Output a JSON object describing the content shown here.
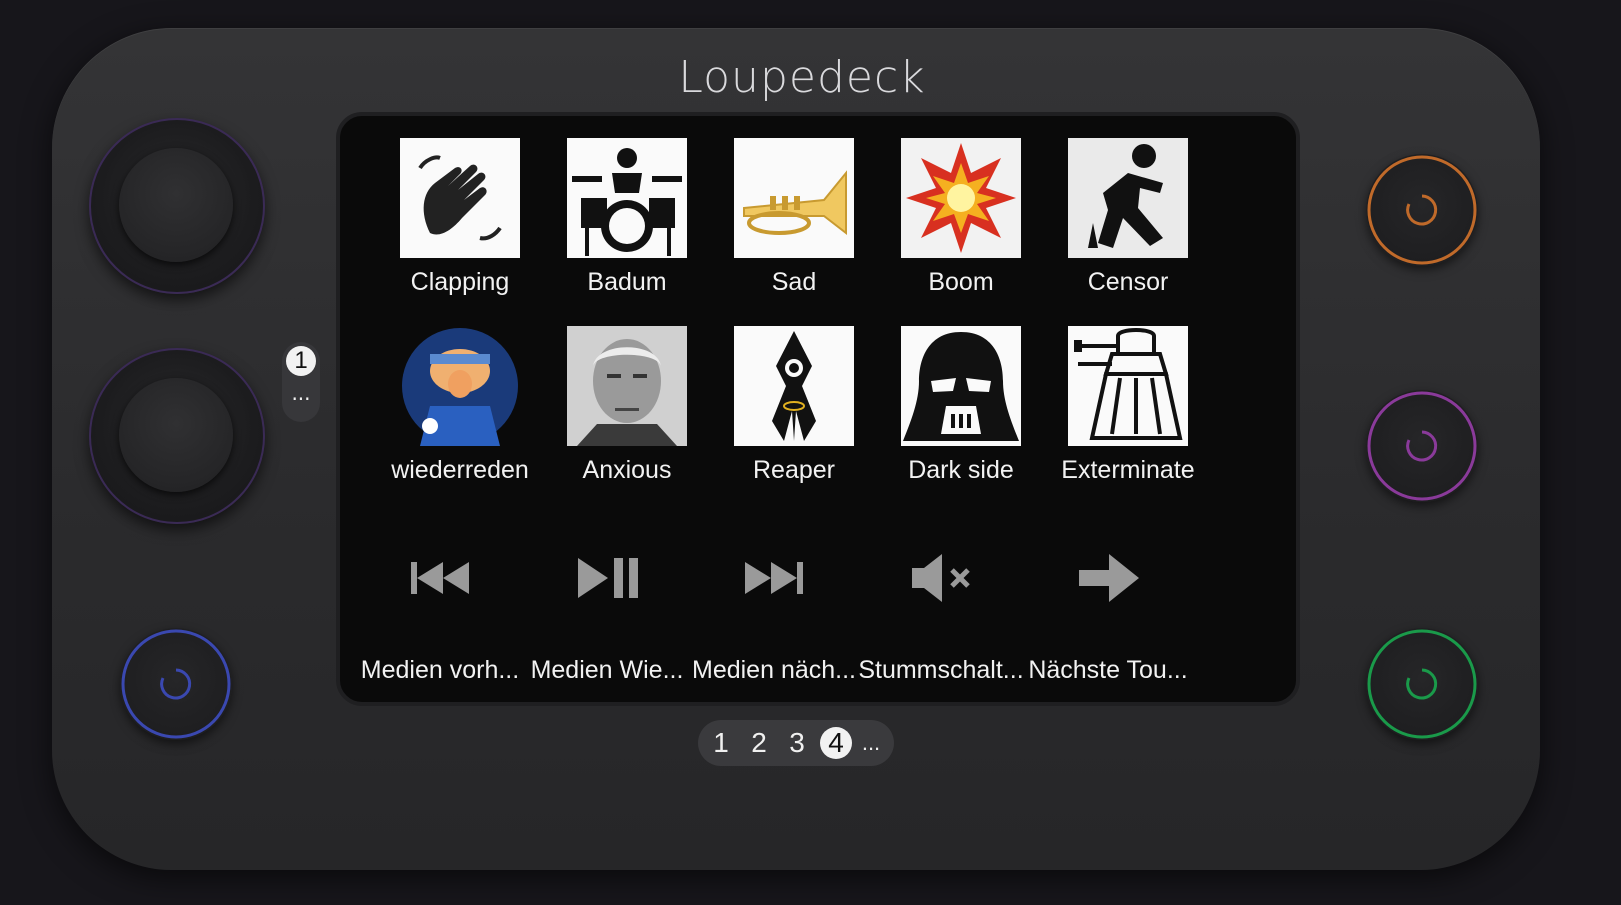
{
  "device": {
    "brand": "Loupedeck"
  },
  "side_page": {
    "number": "1",
    "more": "..."
  },
  "tiles_row1": [
    {
      "label": "Clapping",
      "icon": "clapping-hands-icon"
    },
    {
      "label": "Badum",
      "icon": "drummer-icon"
    },
    {
      "label": "Sad",
      "icon": "trumpet-icon"
    },
    {
      "label": "Boom",
      "icon": "explosion-icon"
    },
    {
      "label": "Censor",
      "icon": "censor-figure-icon"
    }
  ],
  "tiles_row2": [
    {
      "label": "wiederreden",
      "icon": "cartoon-avatar-icon"
    },
    {
      "label": "Anxious",
      "icon": "portrait-photo-icon"
    },
    {
      "label": "Reaper",
      "icon": "reaper-ship-icon"
    },
    {
      "label": "Dark side",
      "icon": "darth-vader-icon"
    },
    {
      "label": "Exterminate",
      "icon": "dalek-icon"
    }
  ],
  "controls": [
    {
      "label": "Medien vorh...",
      "icon": "previous-track-icon"
    },
    {
      "label": "Medien Wie...",
      "icon": "play-pause-icon"
    },
    {
      "label": "Medien näch...",
      "icon": "next-track-icon"
    },
    {
      "label": "Stummschalt...",
      "icon": "mute-icon"
    },
    {
      "label": "Nächste Tou...",
      "icon": "arrow-right-icon"
    }
  ],
  "pager": {
    "pages": [
      "1",
      "2",
      "3",
      "4"
    ],
    "active": "4",
    "more": "..."
  },
  "colors": {
    "button_top_right": "#c06a2a",
    "button_mid_right": "#8a3a9a",
    "button_bottom_right": "#1a9a4a",
    "button_bottom_left": "#3a48b0"
  }
}
